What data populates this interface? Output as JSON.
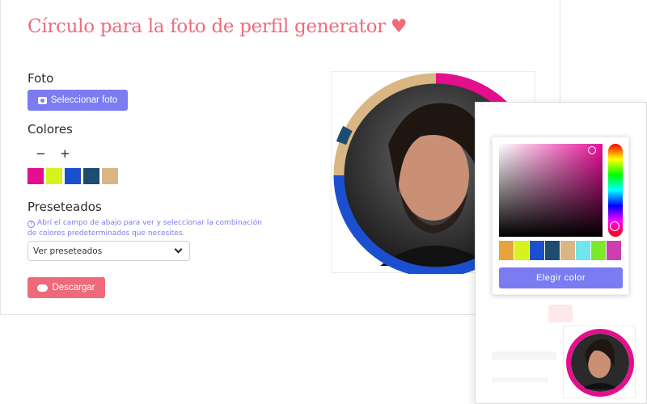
{
  "app": {
    "title": "Círculo para la foto de perfil generator",
    "title_icon": "heart-icon"
  },
  "photo": {
    "label": "Foto",
    "button_label": "Seleccionar foto",
    "button_icon": "camera-icon"
  },
  "colors": {
    "label": "Colores",
    "minus": "−",
    "plus": "+",
    "swatches": [
      "#e30f8c",
      "#d7f21c",
      "#1a4fd0",
      "#1c4c70",
      "#d9b684"
    ]
  },
  "presets": {
    "label": "Preseteados",
    "help_text": "Abrí el campo de abajo para ver y seleccionar la combinación de colores predeterminados que necesites.",
    "select_value": "Ver preseteados"
  },
  "download": {
    "label": "Descargar",
    "icon": "cloud-download-icon"
  },
  "picker": {
    "button_label": "Elegir color",
    "swatches": [
      "#e8a33b",
      "#d7f21c",
      "#1a4fd0",
      "#1c4c70",
      "#d9b684",
      "#6fe6ea",
      "#7bea2c",
      "#cd3fb0"
    ],
    "selected_hue": "#e8119a"
  },
  "ring_colors": [
    "#e30f8c",
    "#1a4fd0",
    "#d9b684"
  ]
}
